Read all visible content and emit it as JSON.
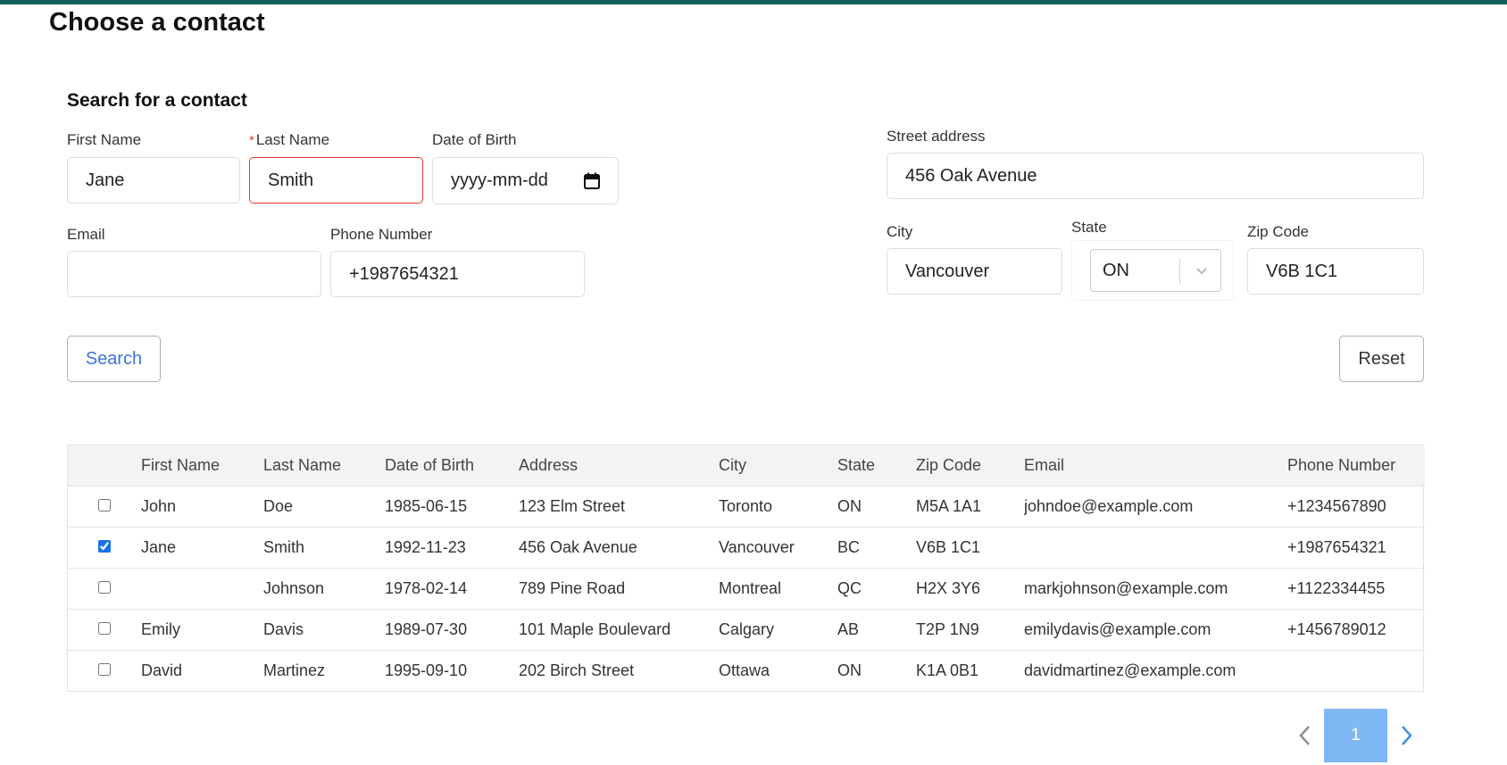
{
  "page": {
    "title": "Choose a contact",
    "section_title": "Search for a contact"
  },
  "search_form": {
    "first_name": {
      "label": "First Name",
      "value": "Jane"
    },
    "last_name": {
      "label": "Last Name",
      "required_marker": "*",
      "value": "Smith"
    },
    "date_of_birth": {
      "label": "Date of Birth",
      "placeholder": "yyyy-mm-dd"
    },
    "email": {
      "label": "Email",
      "value": ""
    },
    "phone": {
      "label": "Phone Number",
      "value": "+1987654321"
    },
    "street": {
      "label": "Street address",
      "value": "456 Oak Avenue"
    },
    "city": {
      "label": "City",
      "value": "Vancouver"
    },
    "state": {
      "label": "State",
      "selected": "ON"
    },
    "zip": {
      "label": "Zip Code",
      "value": "V6B 1C1"
    },
    "search_button": "Search",
    "reset_button": "Reset"
  },
  "results_table": {
    "columns": [
      "First Name",
      "Last Name",
      "Date of Birth",
      "Address",
      "City",
      "State",
      "Zip Code",
      "Email",
      "Phone Number"
    ],
    "rows": [
      {
        "checked": false,
        "cells": [
          "John",
          "Doe",
          "1985-06-15",
          "123 Elm Street",
          "Toronto",
          "ON",
          "M5A 1A1",
          "johndoe@example.com",
          "+1234567890"
        ]
      },
      {
        "checked": true,
        "cells": [
          "Jane",
          "Smith",
          "1992-11-23",
          "456 Oak Avenue",
          "Vancouver",
          "BC",
          "V6B 1C1",
          "",
          "+1987654321"
        ]
      },
      {
        "checked": false,
        "cells": [
          "",
          "Johnson",
          "1978-02-14",
          "789 Pine Road",
          "Montreal",
          "QC",
          "H2X 3Y6",
          "markjohnson@example.com",
          "+1122334455"
        ]
      },
      {
        "checked": false,
        "cells": [
          "Emily",
          "Davis",
          "1989-07-30",
          "101 Maple Boulevard",
          "Calgary",
          "AB",
          "T2P 1N9",
          "emilydavis@example.com",
          "+1456789012"
        ]
      },
      {
        "checked": false,
        "cells": [
          "David",
          "Martinez",
          "1995-09-10",
          "202 Birch Street",
          "Ottawa",
          "ON",
          "K1A 0B1",
          "davidmartinez@example.com",
          ""
        ]
      }
    ]
  },
  "pagination": {
    "current_page": "1"
  },
  "icons": {
    "date": "calendar-icon",
    "select": "chevron-down-icon",
    "prev": "chevron-left-icon",
    "next": "chevron-right-icon"
  },
  "colors": {
    "accent_bar": "#115e59",
    "link_blue": "#3d74d6",
    "error_red": "#e53935",
    "page_active": "#7fb8f5"
  }
}
